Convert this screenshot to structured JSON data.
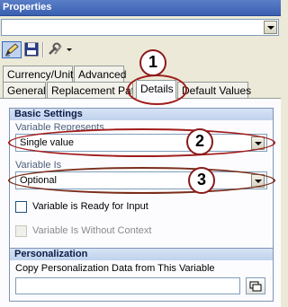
{
  "window": {
    "title": "Properties"
  },
  "tabs": [
    {
      "label": "Currency/Unit"
    },
    {
      "label": "Advanced"
    },
    {
      "label": "General"
    },
    {
      "label": "Replacement Path"
    },
    {
      "label": "Details"
    },
    {
      "label": "Default Values"
    }
  ],
  "basic_settings": {
    "heading": "Basic Settings",
    "represents_label": "Variable Represents",
    "represents_value": "Single value",
    "is_label": "Variable Is",
    "is_value": "Optional",
    "ready_for_input": {
      "label": "Variable is Ready for Input",
      "checked": false
    },
    "without_context": {
      "label": "Variable Is Without Context",
      "checked": false,
      "disabled": true
    }
  },
  "personalization": {
    "heading": "Personalization",
    "copy_label": "Copy Personalization Data from This Variable",
    "copy_value": ""
  },
  "callouts": [
    {
      "num": "1"
    },
    {
      "num": "2"
    },
    {
      "num": "3"
    }
  ],
  "colors": {
    "callout_ring": "#a01c1c",
    "group_header": "#c0d2ed",
    "title_bar": "#3a5fb0"
  }
}
